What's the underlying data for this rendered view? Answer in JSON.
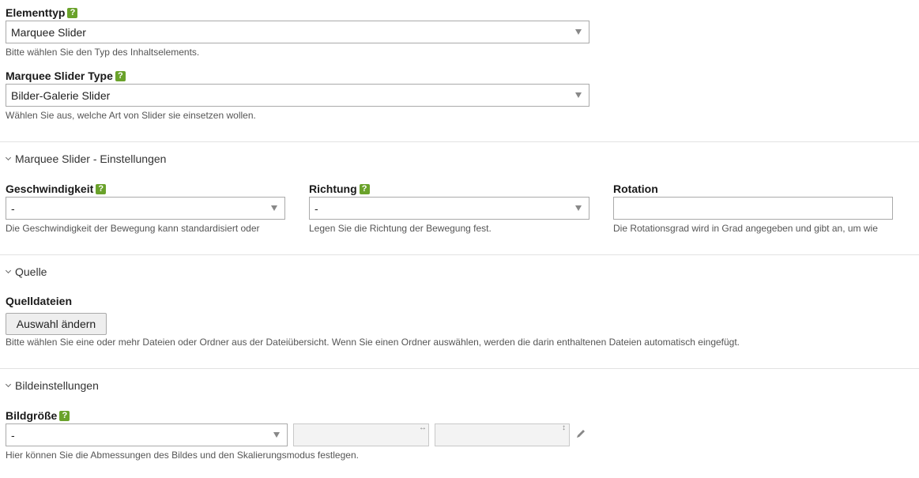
{
  "elementtyp": {
    "label": "Elementtyp",
    "value": "Marquee Slider",
    "desc": "Bitte wählen Sie den Typ des Inhaltselements."
  },
  "slider_type": {
    "label": "Marquee Slider Type",
    "value": "Bilder-Galerie Slider",
    "desc": "Wählen Sie aus, welche Art von Slider sie einsetzen wollen."
  },
  "settings": {
    "title": "Marquee Slider - Einstellungen",
    "speed": {
      "label": "Geschwindigkeit",
      "value": "-",
      "desc": "Die Geschwindigkeit der Bewegung kann standardisiert oder"
    },
    "direction": {
      "label": "Richtung",
      "value": "-",
      "desc": "Legen Sie die Richtung der Bewegung fest."
    },
    "rotation": {
      "label": "Rotation",
      "value": "",
      "desc": "Die Rotationsgrad wird in Grad angegeben und gibt an, um wie"
    }
  },
  "source": {
    "title": "Quelle",
    "files_label": "Quelldateien",
    "button": "Auswahl ändern",
    "desc": "Bitte wählen Sie eine oder mehr Dateien oder Ordner aus der Dateiübersicht. Wenn Sie einen Ordner auswählen, werden die darin enthaltenen Dateien automatisch eingefügt."
  },
  "image_settings": {
    "title": "Bildeinstellungen",
    "size_label": "Bildgröße",
    "size_value": "-",
    "width_value": "",
    "height_value": "",
    "desc": "Hier können Sie die Abmessungen des Bildes und den Skalierungsmodus festlegen."
  },
  "icons": {
    "help": "help-question-icon",
    "caret": "caret-down-icon",
    "chevron": "chevron-down-icon",
    "width": "horizontal-arrows-icon",
    "height": "vertical-arrows-icon",
    "edit": "pencil-icon"
  },
  "colors": {
    "help_icon": "#6aa22b",
    "border": "#aaaaaa",
    "divider": "#e2e2e2"
  }
}
